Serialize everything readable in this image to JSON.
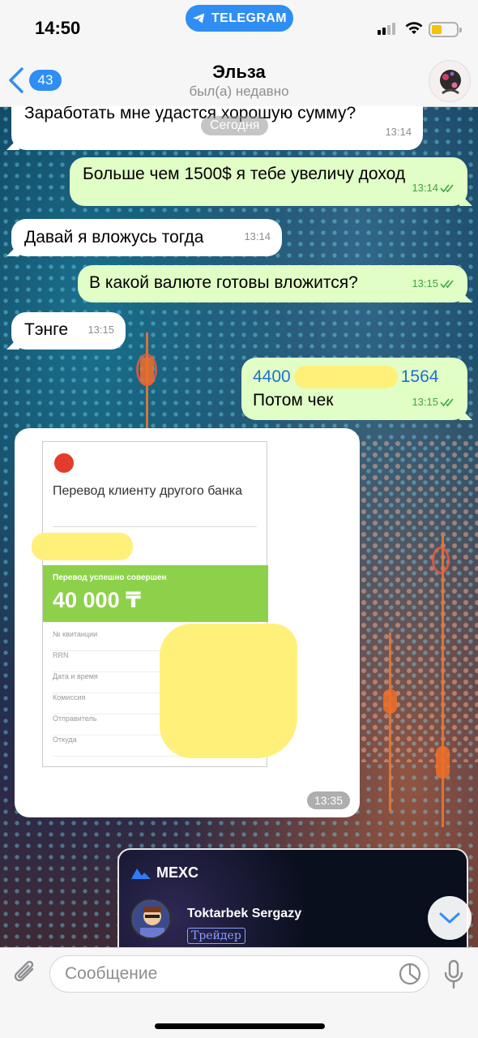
{
  "status_bar": {
    "time": "14:50",
    "app_pill": "TELEGRAM"
  },
  "header": {
    "back_count": "43",
    "name": "Эльза",
    "status": "был(а) недавно"
  },
  "chat": {
    "date_separator": "Сегодня",
    "messages": [
      {
        "direction": "in",
        "text": "Заработать мне удастся хорошую сумму?",
        "time": "13:14"
      },
      {
        "direction": "out",
        "text": "Больше чем 1500$ я тебе увеличу доход",
        "time": "13:14",
        "read": true
      },
      {
        "direction": "in",
        "text": "Давай я вложусь тогда",
        "time": "13:14"
      },
      {
        "direction": "out",
        "text": "В какой валюте готовы вложится?",
        "time": "13:15",
        "read": true
      },
      {
        "direction": "in",
        "text": "Тэнге",
        "time": "13:15"
      },
      {
        "direction": "out",
        "card_start": "4400",
        "card_end": "1564",
        "text": "Потом чек",
        "time": "13:15",
        "read": true
      }
    ],
    "receipt": {
      "title": "Перевод клиенту другого банка",
      "status": "Перевод успешно совершен",
      "amount": "40 000 ₸",
      "fields": [
        "№ квитанции",
        "RRN",
        "Дата и время",
        "Комиссия",
        "Отправитель",
        "Откуда"
      ],
      "time": "13:35"
    },
    "mexc_card": {
      "brand": "MEXC",
      "trader_name": "Toktarbek Sergazy",
      "role": "Трейдер"
    }
  },
  "input": {
    "placeholder": "Сообщение"
  },
  "colors": {
    "accent": "#2f8ef3",
    "outgoing_bubble": "#e1fec6",
    "incoming_bubble": "#ffffff",
    "check": "#3fa541"
  }
}
